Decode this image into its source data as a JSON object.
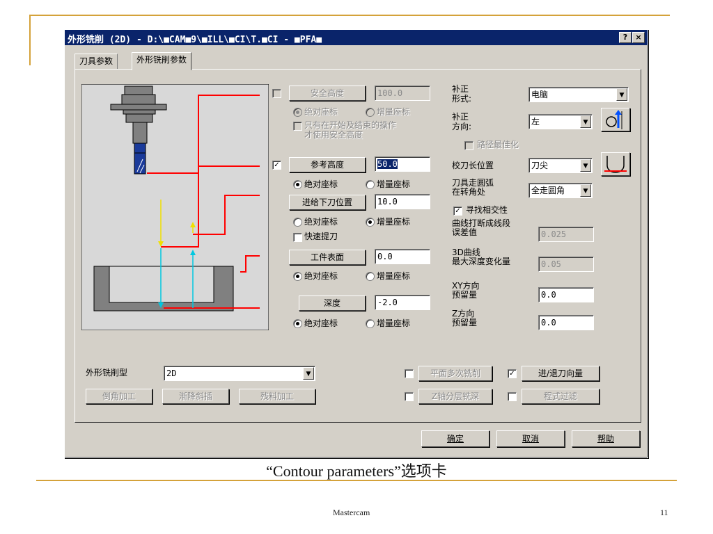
{
  "dialog": {
    "title": "外形铣削 (2D) - D:\\■CAM■9\\■ILL\\■CI\\T.■CI - ■PFA■",
    "help_glyph": "?",
    "close_glyph": "×",
    "tabs": [
      {
        "label": "刀具参数"
      },
      {
        "label": "外形铣削参数"
      }
    ]
  },
  "heights": {
    "safety": {
      "label": "安全高度",
      "value": "100.0",
      "enabled": false
    },
    "safety_abs": "绝对座标",
    "safety_inc": "增量座标",
    "safety_only": "只有在开始及结束的操作",
    "safety_only2": "才使用安全高度",
    "retract": {
      "label": "参考高度",
      "value": "50.0",
      "checked": true
    },
    "retract_abs": "绝对座标",
    "retract_inc": "增量座标",
    "feed": {
      "label": "进给下刀位置",
      "value": "10.0"
    },
    "feed_abs": "绝对座标",
    "feed_inc": "增量座标",
    "rapid_retract": "快速提刀",
    "top": {
      "label": "工件表面",
      "value": "0.0"
    },
    "top_abs": "绝对座标",
    "top_inc": "增量座标",
    "depth": {
      "label": "深度",
      "value": "-2.0"
    },
    "depth_abs": "绝对座标",
    "depth_inc": "增量座标"
  },
  "comp": {
    "type_label": "补正\n形式:",
    "type_value": "电脑",
    "dir_label": "补正\n方向:",
    "dir_value": "左",
    "optimize": "路径最佳化",
    "tip_label": "校刀长位置",
    "tip_value": "刀尖",
    "roll_label": "刀具走圆弧\n在转角处",
    "roll_value": "全走圆角",
    "intersect": "寻找相交性",
    "lin_tol_label": "曲线打断成线段\n误差值",
    "lin_tol_value": "0.025",
    "max_depth_label": "3D曲线\n最大深度变化量",
    "max_depth_value": "0.05",
    "xy_stock_label": "XY方向\n预留量",
    "xy_stock_value": "0.0",
    "z_stock_label": "Z方向\n预留量",
    "z_stock_value": "0.0"
  },
  "bottom": {
    "type_label": "外形铣削型",
    "type_value": "2D",
    "chamfer": "倒角加工",
    "ramp": "渐降斜插",
    "remachine": "残料加工",
    "multi_passes": "平面多次铣削",
    "leadinout": "进/退刀向量",
    "depth_cuts": "Z轴分层铣深",
    "filter": "程式过滤"
  },
  "actions": {
    "ok": "确定",
    "cancel": "取消",
    "help": "帮助"
  },
  "slide": {
    "caption": "“Contour parameters”选项卡",
    "footer_center": "Mastercam",
    "page_number": "11"
  },
  "colors": {
    "titlebar": "#0a246a",
    "face": "#d4d0c8",
    "accent_line": "#d4a23a",
    "diagram_red": "#ff0000",
    "diagram_cyan": "#00c8e0",
    "diagram_yellow": "#f0e000",
    "tool_blue": "#1a3a9a"
  }
}
